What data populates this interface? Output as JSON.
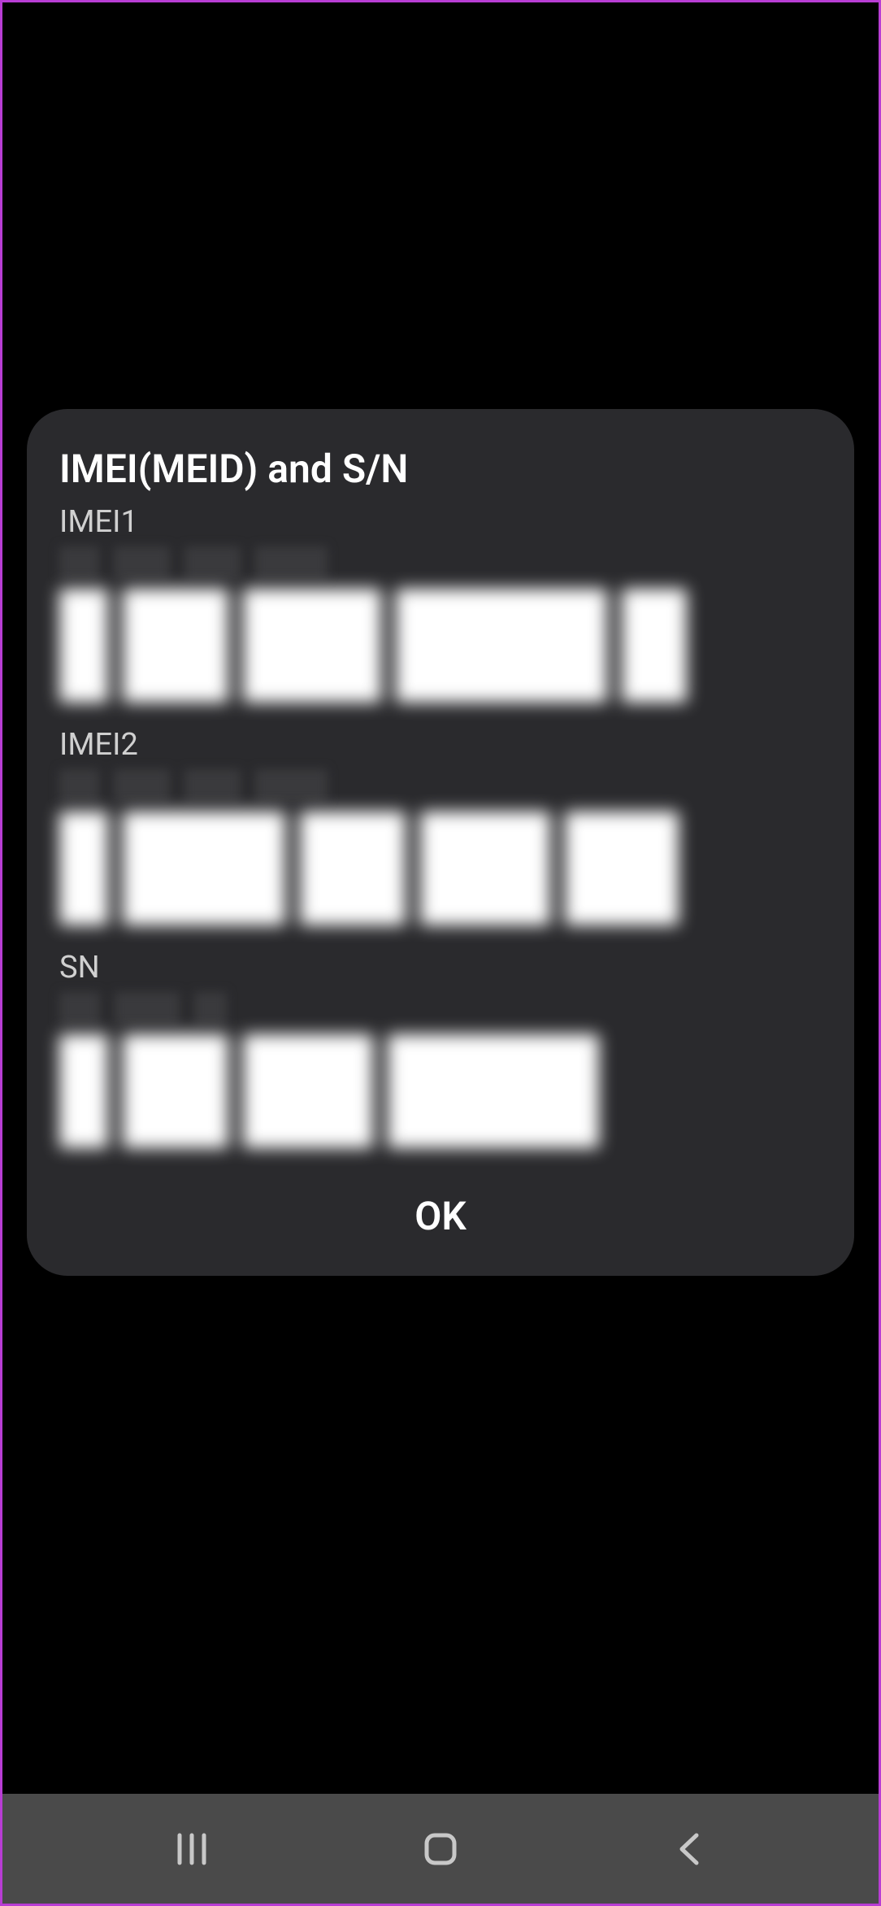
{
  "dialog": {
    "title": "IMEI(MEID) and S/N",
    "sections": {
      "imei1": {
        "label": "IMEI1"
      },
      "imei2": {
        "label": "IMEI2"
      },
      "sn": {
        "label": "SN"
      }
    },
    "button_label": "OK"
  }
}
